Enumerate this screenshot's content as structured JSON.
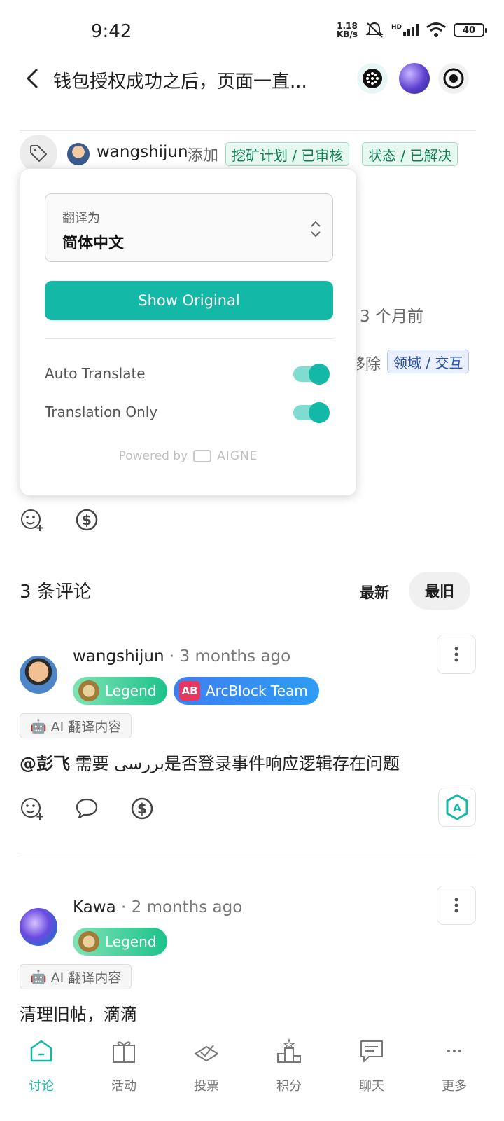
{
  "status_bar": {
    "time": "9:42",
    "net_speed_top": "1.18",
    "net_speed_bottom": "KB/s",
    "signal_label": "HD",
    "battery": "40"
  },
  "header": {
    "title": "钱包授权成功之后，页面一直..."
  },
  "timeline": {
    "user": "wangshijun",
    "action": "添加",
    "chip_mining": "挖矿计划 / 已审核",
    "chip_status": "状态 / 已解决",
    "time_partial": "3 个月前",
    "removed_partial": "移除",
    "chip_domain": "领域 / 交互"
  },
  "translate_popup": {
    "label": "翻译为",
    "language": "简体中文",
    "show_original": "Show Original",
    "auto_translate": "Auto Translate",
    "translation_only": "Translation Only",
    "auto_translate_on": true,
    "translation_only_on": true,
    "powered_by": "Powered by",
    "brand": "AIGNE"
  },
  "comments_section": {
    "count_label": "3 条评论",
    "sort_newest": "最新",
    "sort_oldest": "最旧"
  },
  "comments": [
    {
      "author": "wangshijun",
      "time": "· 3 months ago",
      "badges": [
        "Legend",
        "ArcBlock Team"
      ],
      "ai_label": "AI 翻译内容",
      "mention": "@彭飞",
      "body": " 需要 بررسی是否登录事件响应逻辑存在问题"
    },
    {
      "author": "Kawa",
      "time": "· 2 months ago",
      "badges": [
        "Legend"
      ],
      "ai_label": "AI 翻译内容",
      "body": "清理旧帖，滴滴"
    }
  ],
  "bottom_nav": [
    {
      "label": "讨论",
      "icon": "home-icon",
      "active": true
    },
    {
      "label": "活动",
      "icon": "gift-icon",
      "active": false
    },
    {
      "label": "投票",
      "icon": "vote-icon",
      "active": false
    },
    {
      "label": "积分",
      "icon": "podium-icon",
      "active": false
    },
    {
      "label": "聊天",
      "icon": "chat-icon",
      "active": false
    },
    {
      "label": "更多",
      "icon": "more-icon",
      "active": false
    }
  ],
  "colors": {
    "accent": "#14b8a6",
    "accent_light": "#7fdcd1",
    "legend_badge": "#1cc28a",
    "team_badge": "#3f7ff0"
  }
}
